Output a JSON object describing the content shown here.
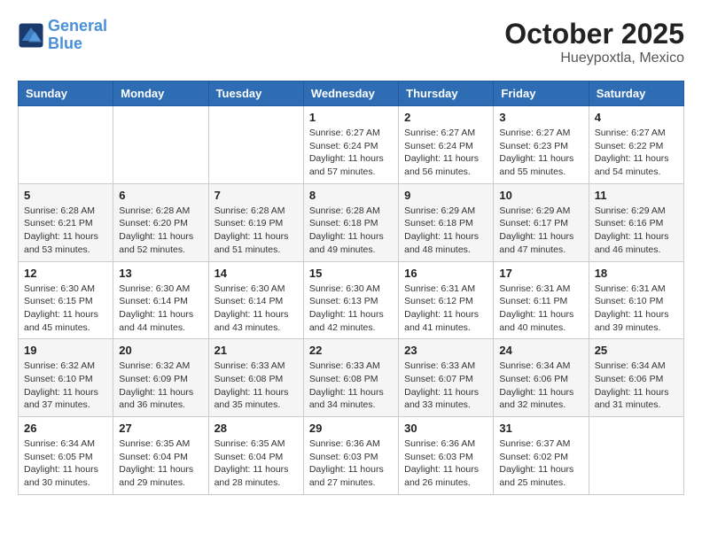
{
  "header": {
    "logo_line1": "General",
    "logo_line2": "Blue",
    "month": "October 2025",
    "location": "Hueypoxtla, Mexico"
  },
  "weekdays": [
    "Sunday",
    "Monday",
    "Tuesday",
    "Wednesday",
    "Thursday",
    "Friday",
    "Saturday"
  ],
  "weeks": [
    [
      {
        "day": "",
        "info": ""
      },
      {
        "day": "",
        "info": ""
      },
      {
        "day": "",
        "info": ""
      },
      {
        "day": "1",
        "info": "Sunrise: 6:27 AM\nSunset: 6:24 PM\nDaylight: 11 hours and 57 minutes."
      },
      {
        "day": "2",
        "info": "Sunrise: 6:27 AM\nSunset: 6:24 PM\nDaylight: 11 hours and 56 minutes."
      },
      {
        "day": "3",
        "info": "Sunrise: 6:27 AM\nSunset: 6:23 PM\nDaylight: 11 hours and 55 minutes."
      },
      {
        "day": "4",
        "info": "Sunrise: 6:27 AM\nSunset: 6:22 PM\nDaylight: 11 hours and 54 minutes."
      }
    ],
    [
      {
        "day": "5",
        "info": "Sunrise: 6:28 AM\nSunset: 6:21 PM\nDaylight: 11 hours and 53 minutes."
      },
      {
        "day": "6",
        "info": "Sunrise: 6:28 AM\nSunset: 6:20 PM\nDaylight: 11 hours and 52 minutes."
      },
      {
        "day": "7",
        "info": "Sunrise: 6:28 AM\nSunset: 6:19 PM\nDaylight: 11 hours and 51 minutes."
      },
      {
        "day": "8",
        "info": "Sunrise: 6:28 AM\nSunset: 6:18 PM\nDaylight: 11 hours and 49 minutes."
      },
      {
        "day": "9",
        "info": "Sunrise: 6:29 AM\nSunset: 6:18 PM\nDaylight: 11 hours and 48 minutes."
      },
      {
        "day": "10",
        "info": "Sunrise: 6:29 AM\nSunset: 6:17 PM\nDaylight: 11 hours and 47 minutes."
      },
      {
        "day": "11",
        "info": "Sunrise: 6:29 AM\nSunset: 6:16 PM\nDaylight: 11 hours and 46 minutes."
      }
    ],
    [
      {
        "day": "12",
        "info": "Sunrise: 6:30 AM\nSunset: 6:15 PM\nDaylight: 11 hours and 45 minutes."
      },
      {
        "day": "13",
        "info": "Sunrise: 6:30 AM\nSunset: 6:14 PM\nDaylight: 11 hours and 44 minutes."
      },
      {
        "day": "14",
        "info": "Sunrise: 6:30 AM\nSunset: 6:14 PM\nDaylight: 11 hours and 43 minutes."
      },
      {
        "day": "15",
        "info": "Sunrise: 6:30 AM\nSunset: 6:13 PM\nDaylight: 11 hours and 42 minutes."
      },
      {
        "day": "16",
        "info": "Sunrise: 6:31 AM\nSunset: 6:12 PM\nDaylight: 11 hours and 41 minutes."
      },
      {
        "day": "17",
        "info": "Sunrise: 6:31 AM\nSunset: 6:11 PM\nDaylight: 11 hours and 40 minutes."
      },
      {
        "day": "18",
        "info": "Sunrise: 6:31 AM\nSunset: 6:10 PM\nDaylight: 11 hours and 39 minutes."
      }
    ],
    [
      {
        "day": "19",
        "info": "Sunrise: 6:32 AM\nSunset: 6:10 PM\nDaylight: 11 hours and 37 minutes."
      },
      {
        "day": "20",
        "info": "Sunrise: 6:32 AM\nSunset: 6:09 PM\nDaylight: 11 hours and 36 minutes."
      },
      {
        "day": "21",
        "info": "Sunrise: 6:33 AM\nSunset: 6:08 PM\nDaylight: 11 hours and 35 minutes."
      },
      {
        "day": "22",
        "info": "Sunrise: 6:33 AM\nSunset: 6:08 PM\nDaylight: 11 hours and 34 minutes."
      },
      {
        "day": "23",
        "info": "Sunrise: 6:33 AM\nSunset: 6:07 PM\nDaylight: 11 hours and 33 minutes."
      },
      {
        "day": "24",
        "info": "Sunrise: 6:34 AM\nSunset: 6:06 PM\nDaylight: 11 hours and 32 minutes."
      },
      {
        "day": "25",
        "info": "Sunrise: 6:34 AM\nSunset: 6:06 PM\nDaylight: 11 hours and 31 minutes."
      }
    ],
    [
      {
        "day": "26",
        "info": "Sunrise: 6:34 AM\nSunset: 6:05 PM\nDaylight: 11 hours and 30 minutes."
      },
      {
        "day": "27",
        "info": "Sunrise: 6:35 AM\nSunset: 6:04 PM\nDaylight: 11 hours and 29 minutes."
      },
      {
        "day": "28",
        "info": "Sunrise: 6:35 AM\nSunset: 6:04 PM\nDaylight: 11 hours and 28 minutes."
      },
      {
        "day": "29",
        "info": "Sunrise: 6:36 AM\nSunset: 6:03 PM\nDaylight: 11 hours and 27 minutes."
      },
      {
        "day": "30",
        "info": "Sunrise: 6:36 AM\nSunset: 6:03 PM\nDaylight: 11 hours and 26 minutes."
      },
      {
        "day": "31",
        "info": "Sunrise: 6:37 AM\nSunset: 6:02 PM\nDaylight: 11 hours and 25 minutes."
      },
      {
        "day": "",
        "info": ""
      }
    ]
  ]
}
